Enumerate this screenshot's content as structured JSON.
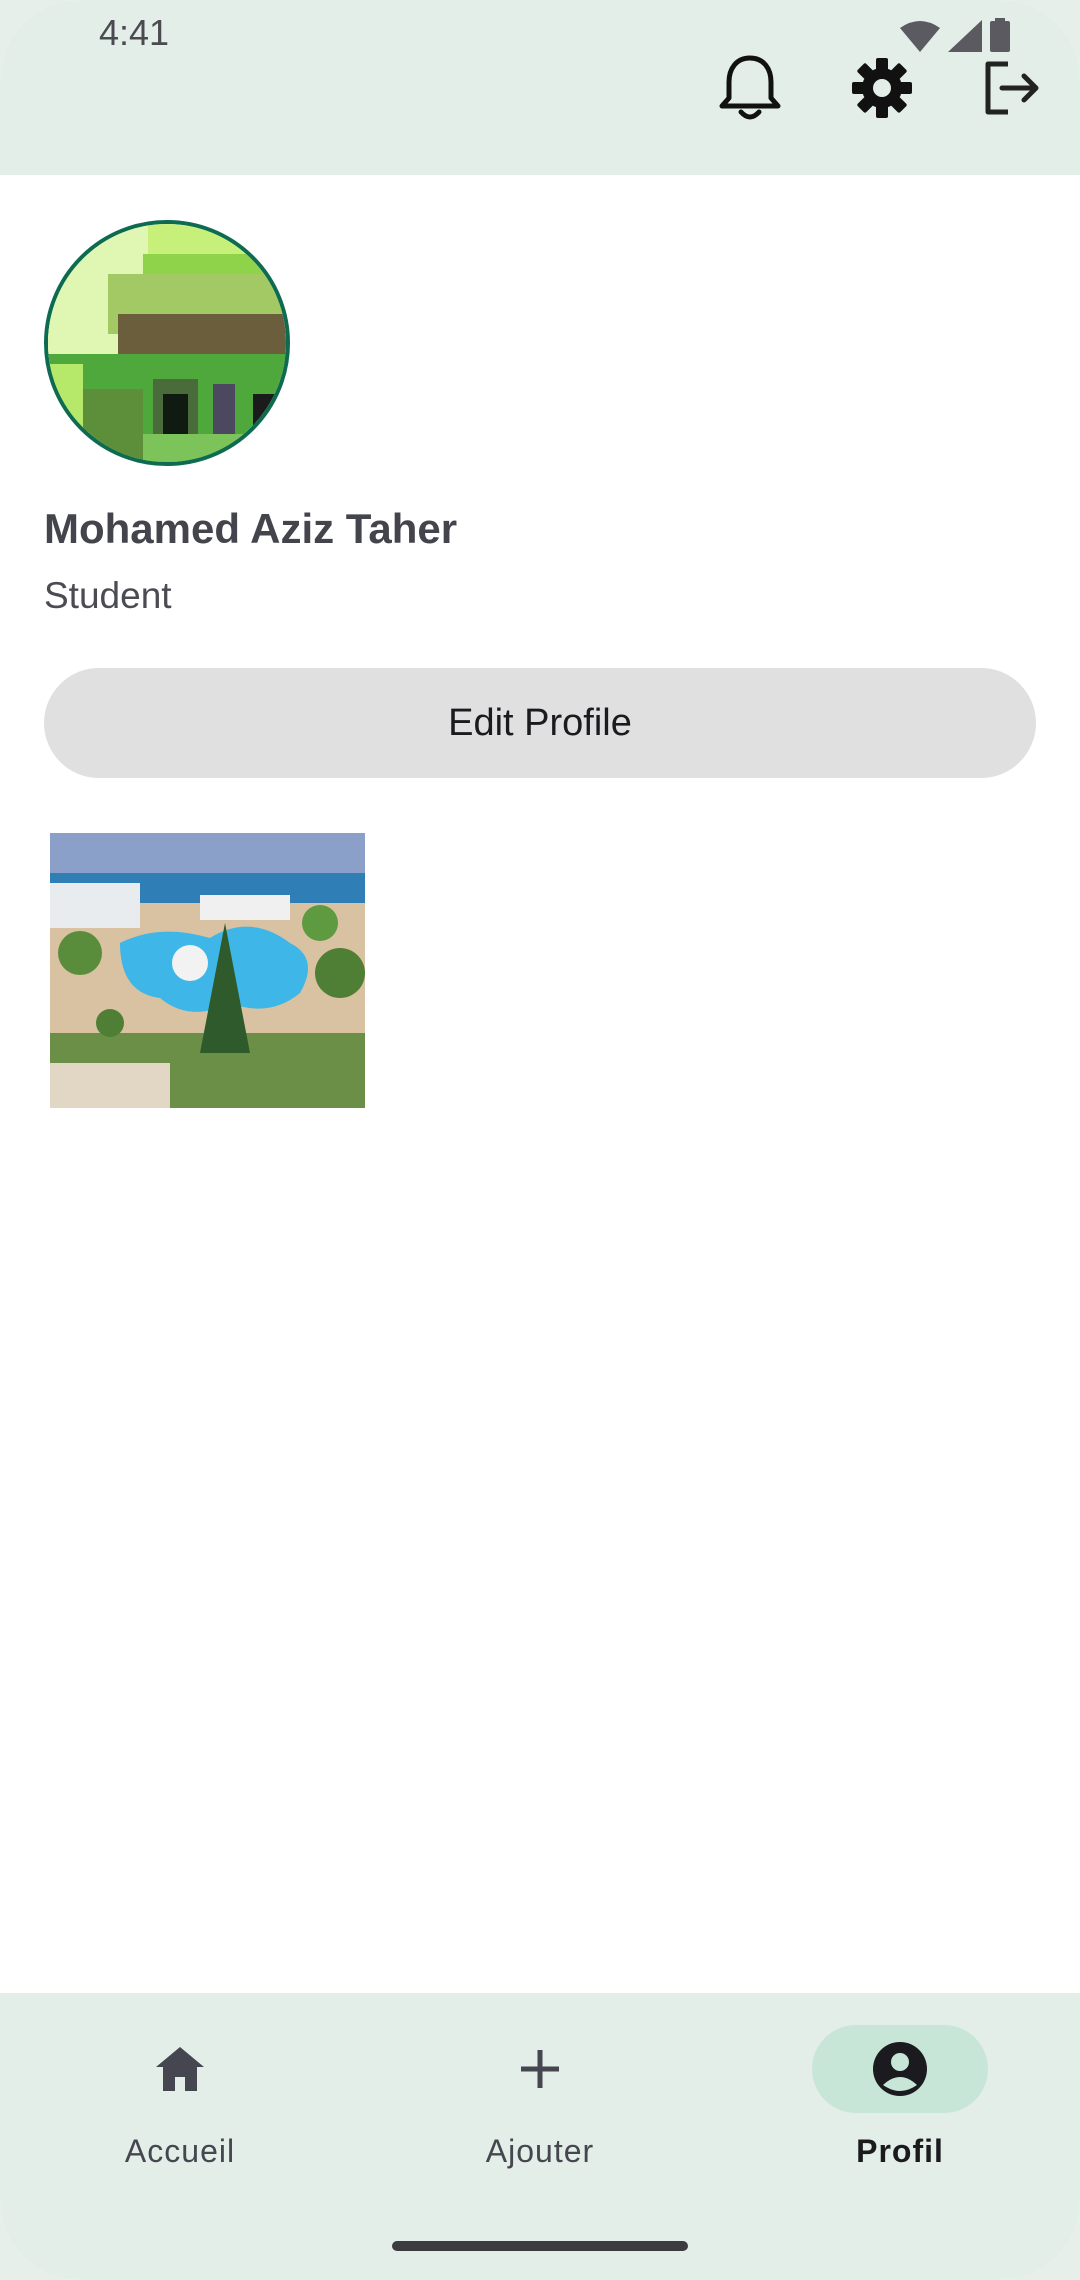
{
  "status_bar": {
    "time": "4:41"
  },
  "header": {
    "actions": [
      {
        "icon": "bell-icon"
      },
      {
        "icon": "gear-icon"
      },
      {
        "icon": "logout-icon"
      }
    ]
  },
  "profile": {
    "name": "Mohamed Aziz Taher",
    "role": "Student",
    "edit_label": "Edit Profile"
  },
  "posts": [
    {
      "image": "resort-pool-photo"
    }
  ],
  "bottom_nav": {
    "items": [
      {
        "label": "Accueil",
        "icon": "home-icon",
        "active": false
      },
      {
        "label": "Ajouter",
        "icon": "plus-icon",
        "active": false
      },
      {
        "label": "Profil",
        "icon": "account-circle-icon",
        "active": true
      }
    ]
  },
  "colors": {
    "bar_background": "#e3eee8",
    "active_indicator": "#c8e6d8",
    "avatar_border": "#0e6b52",
    "button_background": "#e0e0e0"
  }
}
